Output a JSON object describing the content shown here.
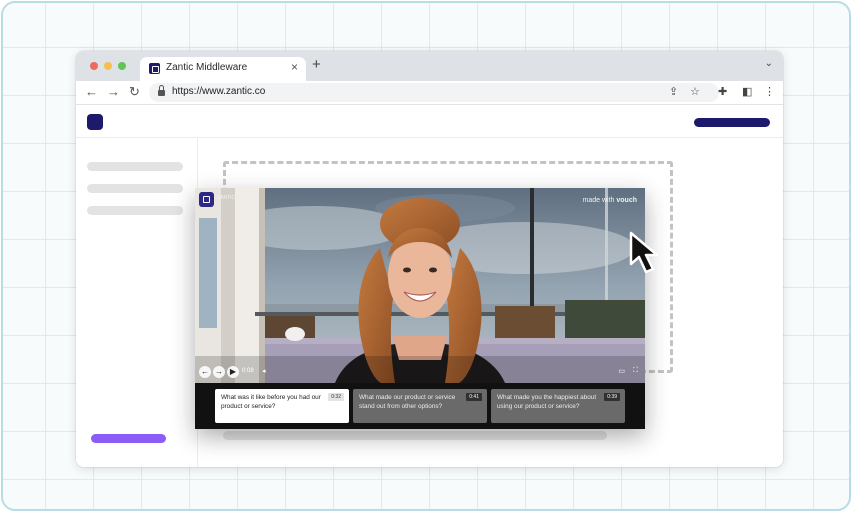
{
  "browser": {
    "tab_title": "Zantic Middleware",
    "tab_close": "×",
    "new_tab": "+",
    "tabs_menu": "⌄",
    "url": "https://www.zantic.co",
    "nav": {
      "back": "←",
      "forward": "→",
      "reload": "↻"
    },
    "actions": {
      "share": "⇪",
      "star": "☆",
      "extensions": "✚",
      "side_panel": "◧",
      "more": "⋮"
    }
  },
  "video": {
    "brand_small": "ZANTIC",
    "watermark_prefix": "made with",
    "watermark_brand": "vouch",
    "controls": {
      "prev": "←",
      "next": "→",
      "play": "▶",
      "time": "0:08",
      "volume": "◂",
      "captions": "▭",
      "fullscreen": "⛶"
    },
    "questions": [
      {
        "text": "What was it like before you had our product or service?",
        "time": "0:32",
        "active": true
      },
      {
        "text": "What made our product or service stand out from other options?",
        "time": "0:41",
        "active": false
      },
      {
        "text": "What made you the happiest about using our product or service?",
        "time": "0:39",
        "active": false
      }
    ]
  },
  "colors": {
    "brand_navy": "#1d1a6b",
    "accent_purple": "#8b5cf6",
    "frame_border": "#b7dde6"
  },
  "icons": [
    "lock-icon",
    "share-icon",
    "star-icon",
    "extension-icon",
    "side-panel-icon",
    "more-icon",
    "mouse-cursor-icon"
  ]
}
